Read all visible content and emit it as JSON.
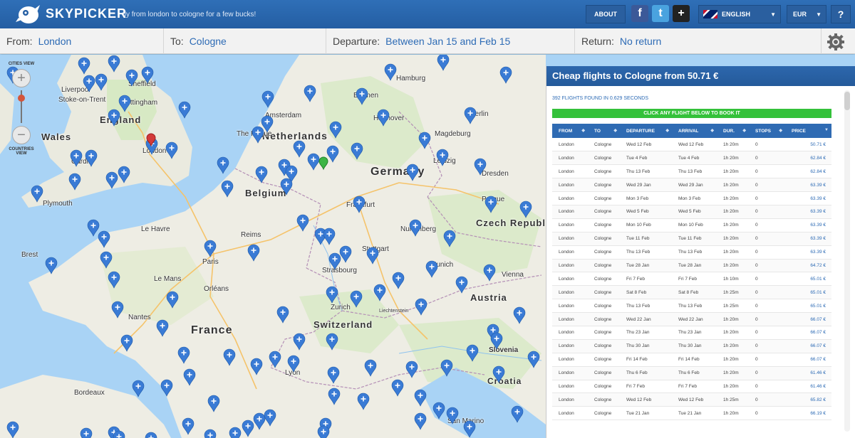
{
  "brand": {
    "name": "SKYPICKER",
    "tagline": "fly from london to cologne for a few bucks!"
  },
  "topnav": {
    "about": "ABOUT",
    "language": "ENGLISH",
    "currency": "EUR",
    "help": "?",
    "facebook": "f",
    "twitter": "t",
    "googleplus": "+"
  },
  "search": {
    "from_label": "From:",
    "from_value": "London",
    "to_label": "To:",
    "to_value": "Cologne",
    "departure_label": "Departure:",
    "departure_value": "Between Jan 15 and Feb 15",
    "return_label": "Return:",
    "return_value": "No return"
  },
  "map": {
    "zoom_top_label": "CITIES VIEW",
    "zoom_bottom_label": "COUNTRIES VIEW",
    "zoom_in": "+",
    "zoom_out": "−",
    "countries": [
      "England",
      "Wales",
      "Netherlands",
      "Belgium",
      "Germany",
      "Czech Republ",
      "France",
      "Switzerland",
      "Austria",
      "Slovenia",
      "Croatia",
      "Liechtenstein"
    ],
    "cities": [
      "Liverpool",
      "Sheffield",
      "Stoke-on-Trent",
      "Nottingham",
      "Cardiff",
      "London",
      "Plymouth",
      "Hamburg",
      "Bremen",
      "Hannover",
      "Berlin",
      "Magdeburg",
      "Leipzig",
      "Dresden",
      "The Hague",
      "Amsterdam",
      "Frankfurt",
      "Nuremberg",
      "Prague",
      "Stuttgart",
      "Munich",
      "Strasbourg",
      "Paris",
      "Reims",
      "Le Mans",
      "Orléans",
      "Nantes",
      "Lyon",
      "Bordeaux",
      "Brest",
      "Vienna",
      "Zurich",
      "San Marino",
      "Le Havre"
    ]
  },
  "results": {
    "title": "Cheap flights to Cologne from 50.71 €",
    "found": "392 FLIGHTS FOUND IN 0.629 SECONDS",
    "book_hint": "CLICK ANY FLIGHT BELOW TO BOOK IT",
    "columns": [
      "FROM",
      "TO",
      "DEPARTURE",
      "ARRIVAL",
      "DUR.",
      "STOPS",
      "PRICE"
    ],
    "rows": [
      [
        "London",
        "Cologne",
        "Wed 12 Feb",
        "Wed 12 Feb",
        "1h 20m",
        "0",
        "50.71 €"
      ],
      [
        "London",
        "Cologne",
        "Tue 4 Feb",
        "Tue 4 Feb",
        "1h 20m",
        "0",
        "62.84 €"
      ],
      [
        "London",
        "Cologne",
        "Thu 13 Feb",
        "Thu 13 Feb",
        "1h 20m",
        "0",
        "62.84 €"
      ],
      [
        "London",
        "Cologne",
        "Wed 29 Jan",
        "Wed 29 Jan",
        "1h 20m",
        "0",
        "63.39 €"
      ],
      [
        "London",
        "Cologne",
        "Mon 3 Feb",
        "Mon 3 Feb",
        "1h 20m",
        "0",
        "63.39 €"
      ],
      [
        "London",
        "Cologne",
        "Wed 5 Feb",
        "Wed 5 Feb",
        "1h 20m",
        "0",
        "63.39 €"
      ],
      [
        "London",
        "Cologne",
        "Mon 10 Feb",
        "Mon 10 Feb",
        "1h 20m",
        "0",
        "63.39 €"
      ],
      [
        "London",
        "Cologne",
        "Tue 11 Feb",
        "Tue 11 Feb",
        "1h 20m",
        "0",
        "63.39 €"
      ],
      [
        "London",
        "Cologne",
        "Thu 13 Feb",
        "Thu 13 Feb",
        "1h 20m",
        "0",
        "63.39 €"
      ],
      [
        "London",
        "Cologne",
        "Tue 28 Jan",
        "Tue 28 Jan",
        "1h 20m",
        "0",
        "64.72 €"
      ],
      [
        "London",
        "Cologne",
        "Fri 7 Feb",
        "Fri 7 Feb",
        "1h 10m",
        "0",
        "65.01 €"
      ],
      [
        "London",
        "Cologne",
        "Sat 8 Feb",
        "Sat 8 Feb",
        "1h 25m",
        "0",
        "65.01 €"
      ],
      [
        "London",
        "Cologne",
        "Thu 13 Feb",
        "Thu 13 Feb",
        "1h 25m",
        "0",
        "65.01 €"
      ],
      [
        "London",
        "Cologne",
        "Wed 22 Jan",
        "Wed 22 Jan",
        "1h 20m",
        "0",
        "66.07 €"
      ],
      [
        "London",
        "Cologne",
        "Thu 23 Jan",
        "Thu 23 Jan",
        "1h 20m",
        "0",
        "66.07 €"
      ],
      [
        "London",
        "Cologne",
        "Thu 30 Jan",
        "Thu 30 Jan",
        "1h 20m",
        "0",
        "66.07 €"
      ],
      [
        "London",
        "Cologne",
        "Fri 14 Feb",
        "Fri 14 Feb",
        "1h 20m",
        "0",
        "66.07 €"
      ],
      [
        "London",
        "Cologne",
        "Thu 6 Feb",
        "Thu 6 Feb",
        "1h 20m",
        "0",
        "61.46 €"
      ],
      [
        "London",
        "Cologne",
        "Fri 7 Feb",
        "Fri 7 Feb",
        "1h 20m",
        "0",
        "61.46 €"
      ],
      [
        "London",
        "Cologne",
        "Wed 12 Feb",
        "Wed 12 Feb",
        "1h 25m",
        "0",
        "65.82 €"
      ],
      [
        "London",
        "Cologne",
        "Tue 21 Jan",
        "Tue 21 Jan",
        "1h 20m",
        "0",
        "66.19 €"
      ]
    ]
  }
}
